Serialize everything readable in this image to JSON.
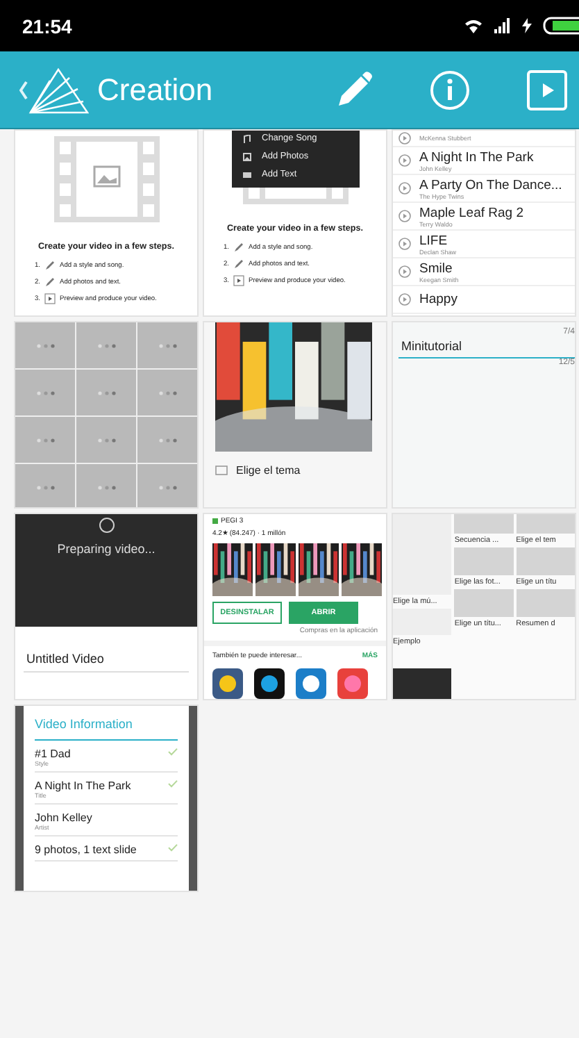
{
  "status_bar": {
    "time": "21:54"
  },
  "app_bar": {
    "title": "Creation"
  },
  "tiles": [
    {
      "kind": "steps",
      "heading": "Create your video in a few steps.",
      "steps": [
        {
          "number": "1.",
          "kind": "edit",
          "text": "Add a style and song."
        },
        {
          "number": "2.",
          "kind": "edit",
          "text": "Add photos and text."
        },
        {
          "number": "3.",
          "kind": "play",
          "text": "Preview and produce your video."
        }
      ]
    },
    {
      "kind": "steps",
      "menu": [
        "Change Song",
        "Add Photos",
        "Add Text"
      ],
      "heading": "Create your video in a few steps.",
      "steps": [
        {
          "number": "1.",
          "kind": "edit",
          "text": "Add a style and song."
        },
        {
          "number": "2.",
          "kind": "edit",
          "text": "Add photos and text."
        },
        {
          "number": "3.",
          "kind": "play",
          "text": "Preview and produce your video."
        }
      ]
    },
    {
      "kind": "songs",
      "songs": [
        {
          "artist": "McKenna Stubbert"
        },
        {
          "title": "A Night In The Park",
          "artist": "John Kelley"
        },
        {
          "title": "A Party On The Dance...",
          "artist": "The Hype Twins"
        },
        {
          "title": "Maple Leaf Rag 2",
          "artist": "Terry Waldo"
        },
        {
          "title": "LIFE",
          "artist": "Declan Shaw"
        },
        {
          "title": "Smile",
          "artist": "Keegan Smith"
        },
        {
          "title": "Happy"
        }
      ]
    },
    {
      "kind": "grid"
    },
    {
      "kind": "theme",
      "label": "Elige el tema"
    },
    {
      "kind": "tutorial",
      "date_top": "7/4",
      "title": "Minitutorial",
      "date_bottom": "12/5"
    },
    {
      "kind": "preparing",
      "status": "Preparing video...",
      "name": "Untitled Video"
    },
    {
      "kind": "store",
      "rating_label": "PEGI 3",
      "stats": "4.2★ (84.247) · 1 millón",
      "uninstall": "DESINSTALAR",
      "open": "ABRIR",
      "note": "Compras en la aplicación",
      "section": "También te puede interesar...",
      "more": "MÁS"
    },
    {
      "kind": "collage",
      "columns": [
        {
          "captions": [
            "Elige la mú...",
            "Ejemplo"
          ]
        },
        {
          "captions": [
            "Secuencia ...",
            "Elige las fot...",
            "Elige un títu..."
          ]
        },
        {
          "captions": [
            "Elige el tem",
            "Elige un títu",
            "Resumen d"
          ]
        }
      ]
    },
    {
      "kind": "info",
      "title": "Video Information",
      "items": [
        {
          "value": "#1 Dad",
          "label": "Style",
          "checked": true
        },
        {
          "value": "A Night In The Park",
          "label": "Title",
          "checked": true
        },
        {
          "value": "John Kelley",
          "label": "Artist",
          "checked": false
        },
        {
          "value": "9 photos, 1 text slide",
          "checked": true
        }
      ]
    }
  ]
}
